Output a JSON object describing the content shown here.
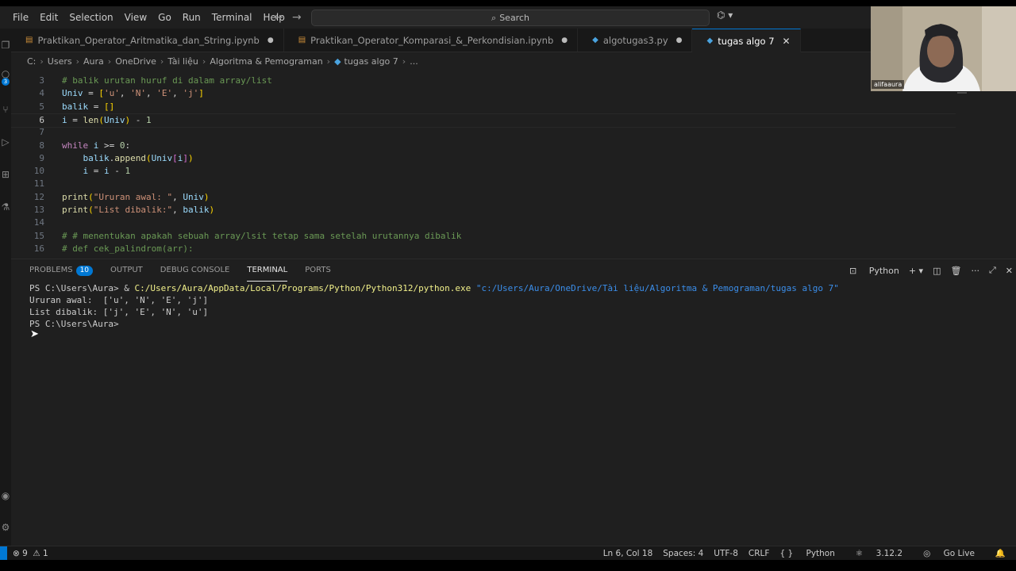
{
  "menu": [
    "File",
    "Edit",
    "Selection",
    "View",
    "Go",
    "Run",
    "Terminal",
    "Help"
  ],
  "search": {
    "label": "Search"
  },
  "tabs": [
    {
      "label": "Praktikan_Operator_Aritmatika_dan_String.ipynb",
      "modified": "●",
      "active": false
    },
    {
      "label": "Praktikan_Operator_Komparasi_&_Perkondisian.ipynb",
      "modified": "●",
      "active": false
    },
    {
      "label": "algotugas3.py",
      "modified": "●",
      "active": false
    },
    {
      "label": "tugas algo 7",
      "close": "✕",
      "active": true
    }
  ],
  "breadcrumb": [
    "C:",
    "Users",
    "Aura",
    "OneDrive",
    "Tài liệu",
    "Algoritma & Pemograman",
    "tugas algo 7",
    "..."
  ],
  "editor": {
    "current_line": "6",
    "lines": [
      {
        "n": "3",
        "text": "# balik urutan huruf di dalam array/list"
      },
      {
        "n": "4",
        "text": "Univ = ['u', 'N', 'E', 'j']"
      },
      {
        "n": "5",
        "text": "balik = []"
      },
      {
        "n": "6",
        "text": "i = len(Univ) - 1"
      },
      {
        "n": "7",
        "text": ""
      },
      {
        "n": "8",
        "text": "while i >= 0:"
      },
      {
        "n": "9",
        "text": "    balik.append(Univ[i])"
      },
      {
        "n": "10",
        "text": "    i = i - 1"
      },
      {
        "n": "11",
        "text": ""
      },
      {
        "n": "12",
        "text": "print(\"Ururan awal: \", Univ)"
      },
      {
        "n": "13",
        "text": "print(\"List dibalik:\", balik)"
      },
      {
        "n": "14",
        "text": ""
      },
      {
        "n": "15",
        "text": "# # menentukan apakah sebuah array/lsit tetap sama setelah urutannya dibalik"
      },
      {
        "n": "16",
        "text": "# def cek_palindrom(arr):"
      }
    ]
  },
  "webcam": {
    "name": "alifaaura"
  },
  "panel": {
    "tabs": [
      {
        "label": "PROBLEMS",
        "badge": "10"
      },
      {
        "label": "OUTPUT"
      },
      {
        "label": "DEBUG CONSOLE"
      },
      {
        "label": "TERMINAL",
        "active": true
      },
      {
        "label": "PORTS"
      }
    ],
    "shell": "Python"
  },
  "terminal": {
    "prompt1": "PS C:\\Users\\Aura> & ",
    "exe": "C:/Users/Aura/AppData/Local/Programs/Python/Python312/python.exe",
    "arg": "\"c:/Users/Aura/OneDrive/Tài liệu/Algoritma & Pemograman/tugas algo 7\"",
    "out1": "Ururan awal:  ['u', 'N', 'E', 'j']",
    "out2": "List dibalik: ['j', 'E', 'N', 'u']",
    "prompt2": "PS C:\\Users\\Aura>"
  },
  "status": {
    "errors": "9",
    "warnings": "1",
    "position": "Ln 6, Col 18",
    "spaces": "Spaces: 4",
    "encoding": "UTF-8",
    "eol": "CRLF",
    "language": "Python",
    "version": "3.12.2",
    "golive": "Go Live"
  }
}
